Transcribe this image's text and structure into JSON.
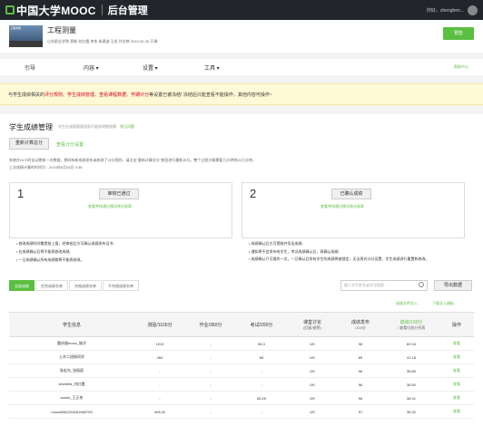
{
  "topbar": {
    "logo": "中国大学MOOC",
    "title": "后台管理",
    "username": "你好，zhenghen..."
  },
  "course": {
    "title": "工程测量",
    "meta": "山东职业学院  郑郁 刘红霞 李伟 朱建波 马龙 孙文婷   2019-02-25 开课",
    "button": "预告"
  },
  "nav": {
    "items": [
      "引导",
      "内容",
      "设置",
      "工具"
    ],
    "help": "帮助中心"
  },
  "warning": {
    "prefix": "与学生成绩相关的",
    "p1": "评分规则",
    "c1": "、",
    "p2": "学生成绩管理",
    "c2": "、",
    "p3": "查看课程数据",
    "c3": "、",
    "p4": "学期计分",
    "suffix": "等设置已被冻结! 冻结后只能查看不能操作，其他内容可操作~"
  },
  "section": {
    "title": "学生成绩管理",
    "note": "学生在成绩管理里面不能修改数据噢",
    "note_link": "常见问题",
    "recalc_btn": "重新计算总分",
    "view_settings": "查看计分设置",
    "desc1": "系统在24小时自动更新一次数据，期间有新成绩发布或修改了计分规则，请点击\"重新计算总分\"按钮进行重新计分。整个过程大概需要几分钟到20几分钟。",
    "desc2": "上次成绩计算的时间为：2019年8月26日 3:38"
  },
  "steps": [
    {
      "num": "1",
      "button": "审核已通过",
      "link": "查看考核通过情况统计报表",
      "bullets": [
        "修改成绩时间需提前上报，经审核后方可确认成绩发布证书;",
        "在成绩确认后将不能再修改成绩;",
        "一旦成绩确认所有成绩都将不能再修改。"
      ]
    },
    {
      "num": "2",
      "button": "已确认成绩",
      "link": "查看考核通过情况统计报表",
      "bullets": [
        "成绩确认后方可提取并导出成绩;",
        "通知将不会发布给学生，考试成绩确认后，再确认成绩;",
        "成绩确认只可操作一次，一旦确认后所有学生的成绩将被锁定，无法再对计分设置、学生成绩进行重置和修改。"
      ]
    }
  ],
  "tabs": [
    "全部成绩",
    "优秀成绩名单",
    "合格成绩名单",
    "不合格成绩名单"
  ],
  "search_placeholder": "输入学生姓名或学号搜索",
  "export_btn": "导出数据",
  "sub_links": [
    "成绩文件导入",
    "下载导入模板"
  ],
  "table": {
    "headers": [
      "学生信息",
      "测验/1100分",
      "作业/360分",
      "考试/200分",
      "课堂讨论",
      "成绩发布",
      "综合成绩",
      "操作"
    ],
    "sub_headers": {
      "discussion": "(回复/被赞)",
      "publish": "/100分",
      "total": "成绩/100分",
      "total_note": "□查看归档分列表"
    },
    "rows": [
      [
        "重庆烟mooc_姚洋",
        "1010",
        "-",
        "96.3",
        "0/0",
        "96",
        "62.04",
        "查看"
      ],
      [
        "土木二班杨同学",
        "260",
        "-",
        "65",
        "0/0",
        "89",
        "41.18",
        "查看"
      ],
      [
        "张宏光_张振庭",
        "-",
        "-",
        "-",
        "0/0",
        "96",
        "36.60",
        "查看"
      ],
      [
        "cindrella_刘红霞",
        "-",
        "-",
        "-",
        "0/0",
        "96",
        "36.60",
        "查看"
      ],
      [
        "wzwls_王正伟",
        "-",
        "-",
        "65.25",
        "0/0",
        "96",
        "36.41",
        "查看"
      ],
      [
        "mooc5661293261665759",
        "408.32",
        "-",
        "-",
        "0/0",
        "97",
        "36.32",
        "查看"
      ]
    ]
  }
}
